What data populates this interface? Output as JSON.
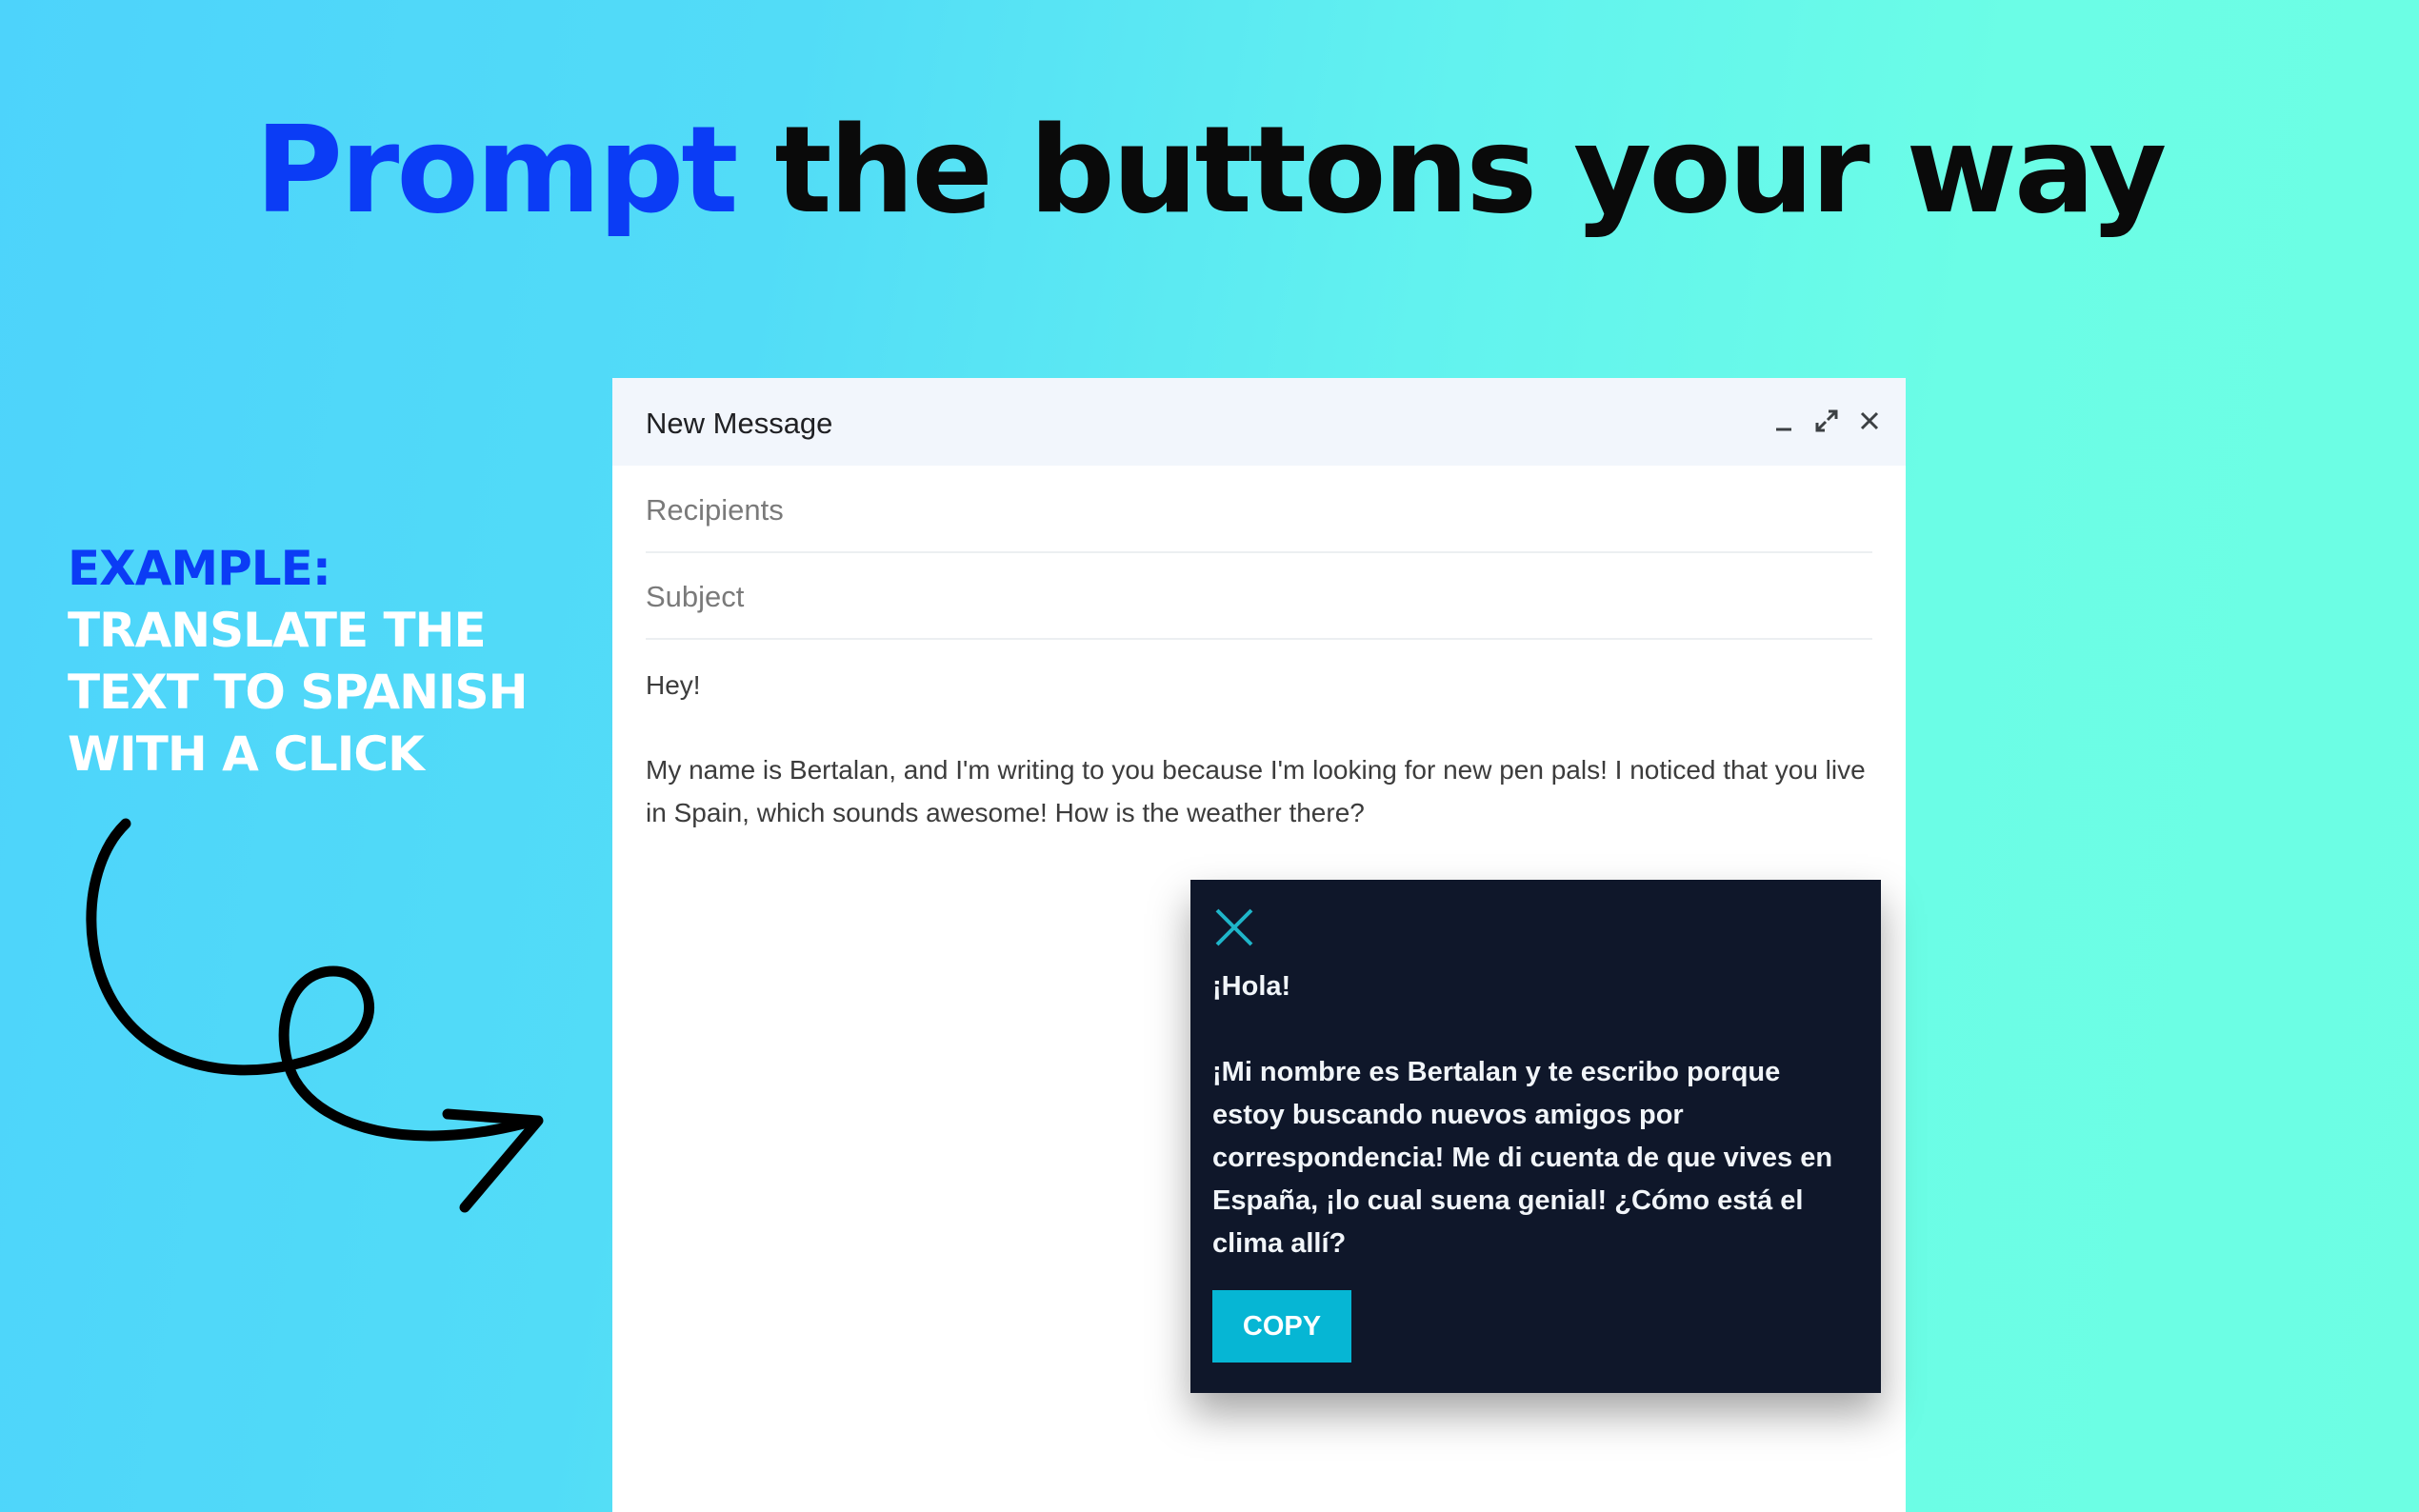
{
  "headline": {
    "accent": "Prompt",
    "rest": "the buttons your way"
  },
  "side_caption": {
    "example": "EXAMPLE:",
    "lines": [
      "TRANSLATE THE",
      "TEXT TO SPANISH",
      "WITH A CLICK"
    ]
  },
  "colors": {
    "accent_blue": "#0b3cf5",
    "background_start": "#4dd3fb",
    "background_end": "#6dfee3",
    "popup_bg": "#0f172a",
    "copy_button": "#06b6d4"
  },
  "composer": {
    "title": "New Message",
    "controls": [
      "minimize-icon",
      "expand-icon",
      "close-icon"
    ],
    "recipients_placeholder": "Recipients",
    "subject_placeholder": "Subject",
    "body": [
      "Hey!",
      "My name is Bertalan, and I'm writing to you because I'm looking for new pen pals! I noticed that you live in Spain, which sounds awesome! How is the weather there?"
    ]
  },
  "translation_popup": {
    "close_icon": "close-icon",
    "lines": [
      "¡Hola!",
      "¡Mi nombre es Bertalan y te escribo porque estoy buscando nuevos amigos por correspondencia! Me di cuenta de que vives en España, ¡lo cual suena genial! ¿Cómo está el clima allí?"
    ],
    "copy_label": "COPY"
  }
}
